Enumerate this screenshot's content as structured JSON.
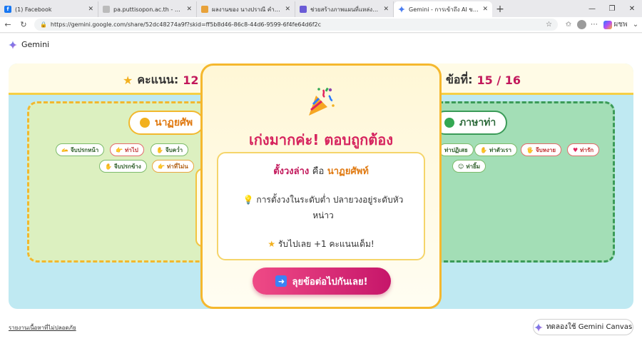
{
  "browser": {
    "tabs": [
      {
        "title": "(1) Facebook",
        "icon": "facebook-icon",
        "color": "#1877f2",
        "active": false
      },
      {
        "title": "pa.puttisopon.ac.th - Search",
        "icon": "search-favicon",
        "color": "#888888",
        "active": false
      },
      {
        "title": "ผลงานของ นางปราณี คำพล - โรงเรียนเ",
        "icon": "school-icon",
        "color": "#e8a23a",
        "active": false
      },
      {
        "title": "ช่วยสร้างภาพแผนที่แหล่งที่มีความใกล้เ",
        "icon": "chat-icon",
        "color": "#6a5bd6",
        "active": false
      },
      {
        "title": "Gemini - การเข้าถึง AI ของ Google ได้",
        "icon": "gemini-icon",
        "color": "#4a7df0",
        "active": true
      }
    ],
    "url": "https://gemini.google.com/share/52dc48274a9f?skid=ff5b8d46-86c8-44d6-9599-6f4fe64d6f2c",
    "profile_label": "ผชพ"
  },
  "app": {
    "name": "Gemini"
  },
  "game": {
    "score_label": "คะแนน:",
    "score_value": "12",
    "question_label": "ข้อที่:",
    "question_value": "15 / 16",
    "left_category": "นาฏยศัพ",
    "right_category": "ภาษาท่า",
    "left_chips": [
      {
        "label": "จีบปรกหน้า",
        "style": "g"
      },
      {
        "label": "ท่าไป",
        "style": "r"
      },
      {
        "label": "จีบคว่ำ",
        "style": "g"
      },
      {
        "label": "จีบปรกข้าง",
        "style": "g"
      },
      {
        "label": "ท่าที่ไม่น",
        "style": "r"
      }
    ],
    "right_chips": [
      {
        "label": "ท่าปฏิเสธ",
        "style": "g"
      },
      {
        "label": "ท่าตัวเรา",
        "style": "g"
      },
      {
        "label": "จีบหงาย",
        "style": "r"
      },
      {
        "label": "ท่ารัก",
        "style": "r"
      },
      {
        "label": "ท่ายิ้ม",
        "style": "g"
      }
    ]
  },
  "modal": {
    "title": "เก่งมากค่ะ! ตอบถูกต้อง",
    "answer_word": "ตั้งวงล่าง",
    "answer_connector": "คือ",
    "answer_category": "นาฏยศัพท์",
    "hint": "การตั้งวงในระดับต่ำ ปลายวงอยู่ระดับหัวหน่าว",
    "bonus": "รับไปเลย +1 คะแนนเด็ม!",
    "next_button": "ลุยข้อต่อไปกันเลย!"
  },
  "footer": {
    "report_link": "รายงานเนื้อหาที่ไม่ปลอดภัย",
    "canvas_button": "ทดลองใช้ Gemini Canvas"
  }
}
